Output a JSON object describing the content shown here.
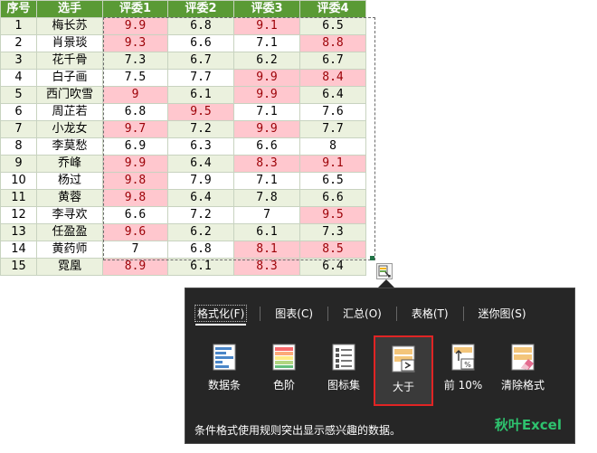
{
  "table": {
    "headers": [
      "序号",
      "选手",
      "评委1",
      "评委2",
      "评委3",
      "评委4"
    ],
    "rows": [
      {
        "no": "1",
        "name": "梅长苏",
        "s": [
          "9.9",
          "6.8",
          "9.1",
          "6.5"
        ],
        "hl": [
          true,
          false,
          true,
          false
        ]
      },
      {
        "no": "2",
        "name": "肖景琰",
        "s": [
          "9.3",
          "6.6",
          "7.1",
          "8.8"
        ],
        "hl": [
          true,
          false,
          false,
          true
        ]
      },
      {
        "no": "3",
        "name": "花千骨",
        "s": [
          "7.3",
          "6.7",
          "6.2",
          "6.7"
        ],
        "hl": [
          false,
          false,
          false,
          false
        ]
      },
      {
        "no": "4",
        "name": "白子画",
        "s": [
          "7.5",
          "7.7",
          "9.9",
          "8.4"
        ],
        "hl": [
          false,
          false,
          true,
          true
        ]
      },
      {
        "no": "5",
        "name": "西门吹雪",
        "s": [
          "9",
          "6.1",
          "9.9",
          "6.4"
        ],
        "hl": [
          true,
          false,
          true,
          false
        ]
      },
      {
        "no": "6",
        "name": "周芷若",
        "s": [
          "6.8",
          "9.5",
          "7.1",
          "7.6"
        ],
        "hl": [
          false,
          true,
          false,
          false
        ]
      },
      {
        "no": "7",
        "name": "小龙女",
        "s": [
          "9.7",
          "7.2",
          "9.9",
          "7.7"
        ],
        "hl": [
          true,
          false,
          true,
          false
        ]
      },
      {
        "no": "8",
        "name": "李莫愁",
        "s": [
          "6.9",
          "6.3",
          "6.6",
          "8"
        ],
        "hl": [
          false,
          false,
          false,
          false
        ]
      },
      {
        "no": "9",
        "name": "乔峰",
        "s": [
          "9.9",
          "6.4",
          "8.3",
          "9.1"
        ],
        "hl": [
          true,
          false,
          true,
          true
        ]
      },
      {
        "no": "10",
        "name": "杨过",
        "s": [
          "9.8",
          "7.9",
          "7.1",
          "6.5"
        ],
        "hl": [
          true,
          false,
          false,
          false
        ]
      },
      {
        "no": "11",
        "name": "黄蓉",
        "s": [
          "9.8",
          "6.4",
          "7.8",
          "6.6"
        ],
        "hl": [
          true,
          false,
          false,
          false
        ]
      },
      {
        "no": "12",
        "name": "李寻欢",
        "s": [
          "6.6",
          "7.2",
          "7",
          "9.5"
        ],
        "hl": [
          false,
          false,
          false,
          true
        ]
      },
      {
        "no": "13",
        "name": "任盈盈",
        "s": [
          "9.6",
          "6.2",
          "6.1",
          "7.3"
        ],
        "hl": [
          true,
          false,
          false,
          false
        ]
      },
      {
        "no": "14",
        "name": "黄药师",
        "s": [
          "7",
          "6.8",
          "8.1",
          "8.5"
        ],
        "hl": [
          false,
          false,
          true,
          true
        ]
      },
      {
        "no": "15",
        "name": "霓凰",
        "s": [
          "8.9",
          "6.1",
          "8.3",
          "6.4"
        ],
        "hl": [
          true,
          false,
          true,
          false
        ]
      }
    ]
  },
  "quick_analysis": {
    "tabs": [
      {
        "label": "格式化(F)",
        "active": true
      },
      {
        "label": "图表(C)",
        "active": false
      },
      {
        "label": "汇总(O)",
        "active": false
      },
      {
        "label": "表格(T)",
        "active": false
      },
      {
        "label": "迷你图(S)",
        "active": false
      }
    ],
    "tools": [
      {
        "label": "数据条",
        "icon": "data-bars-icon",
        "selected": false
      },
      {
        "label": "色阶",
        "icon": "color-scale-icon",
        "selected": false
      },
      {
        "label": "图标集",
        "icon": "icon-set-icon",
        "selected": false
      },
      {
        "label": "大于",
        "icon": "greater-than-icon",
        "selected": true
      },
      {
        "label": "前 10%",
        "icon": "top-10-percent-icon",
        "selected": false
      },
      {
        "label": "清除格式",
        "icon": "clear-format-icon",
        "selected": false
      }
    ],
    "description": "条件格式使用规则突出显示感兴趣的数据。",
    "brand": "秋叶Excel"
  },
  "colors": {
    "header_bg": "#5a9a35",
    "band_bg": "#ebf1de",
    "highlight_bg": "#ffc7ce",
    "highlight_text": "#9c0006",
    "panel_bg": "#262626",
    "selected_border": "#e02424",
    "brand": "#2ec26e"
  }
}
